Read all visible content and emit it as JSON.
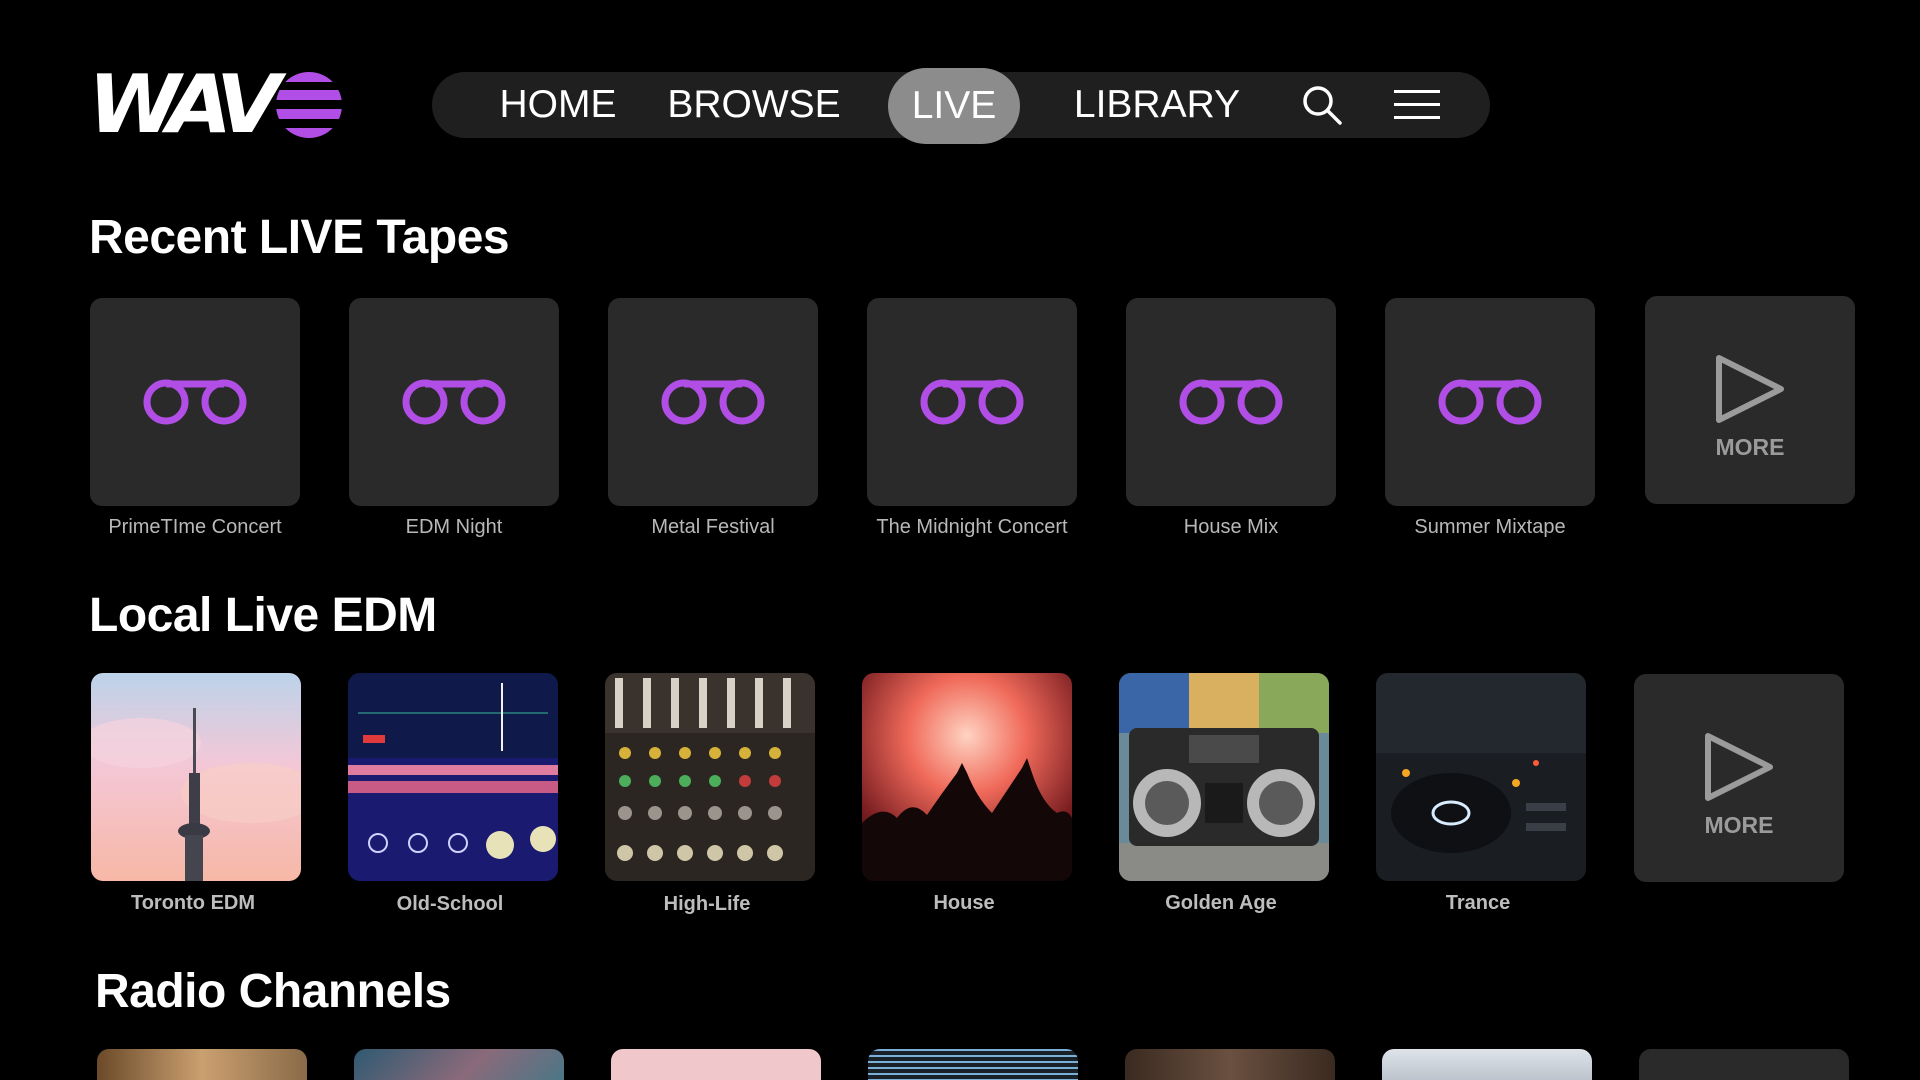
{
  "brand": {
    "logo_text": "WAV",
    "accent": "#b14ee6"
  },
  "nav": {
    "items": [
      {
        "label": "HOME"
      },
      {
        "label": "BROWSE"
      },
      {
        "label": "LIVE",
        "active": true
      },
      {
        "label": "LIBRARY"
      }
    ],
    "icons": [
      "search-icon",
      "menu-icon"
    ]
  },
  "sections": {
    "recent": {
      "title": "Recent LIVE Tapes",
      "items": [
        {
          "label": "PrimeTIme Concert",
          "icon": "tape-icon"
        },
        {
          "label": "EDM Night",
          "icon": "tape-icon"
        },
        {
          "label": "Metal Festival",
          "icon": "tape-icon"
        },
        {
          "label": "The Midnight Concert",
          "icon": "tape-icon"
        },
        {
          "label": "House Mix",
          "icon": "tape-icon"
        },
        {
          "label": "Summer Mixtape",
          "icon": "tape-icon"
        }
      ],
      "more_label": "MORE"
    },
    "local": {
      "title": "Local Live EDM",
      "items": [
        {
          "label": "Toronto EDM"
        },
        {
          "label": "Old-School"
        },
        {
          "label": "High-Life"
        },
        {
          "label": "House"
        },
        {
          "label": "Golden Age"
        },
        {
          "label": "Trance"
        }
      ],
      "more_label": "MORE"
    },
    "radio": {
      "title": "Radio Channels"
    }
  }
}
